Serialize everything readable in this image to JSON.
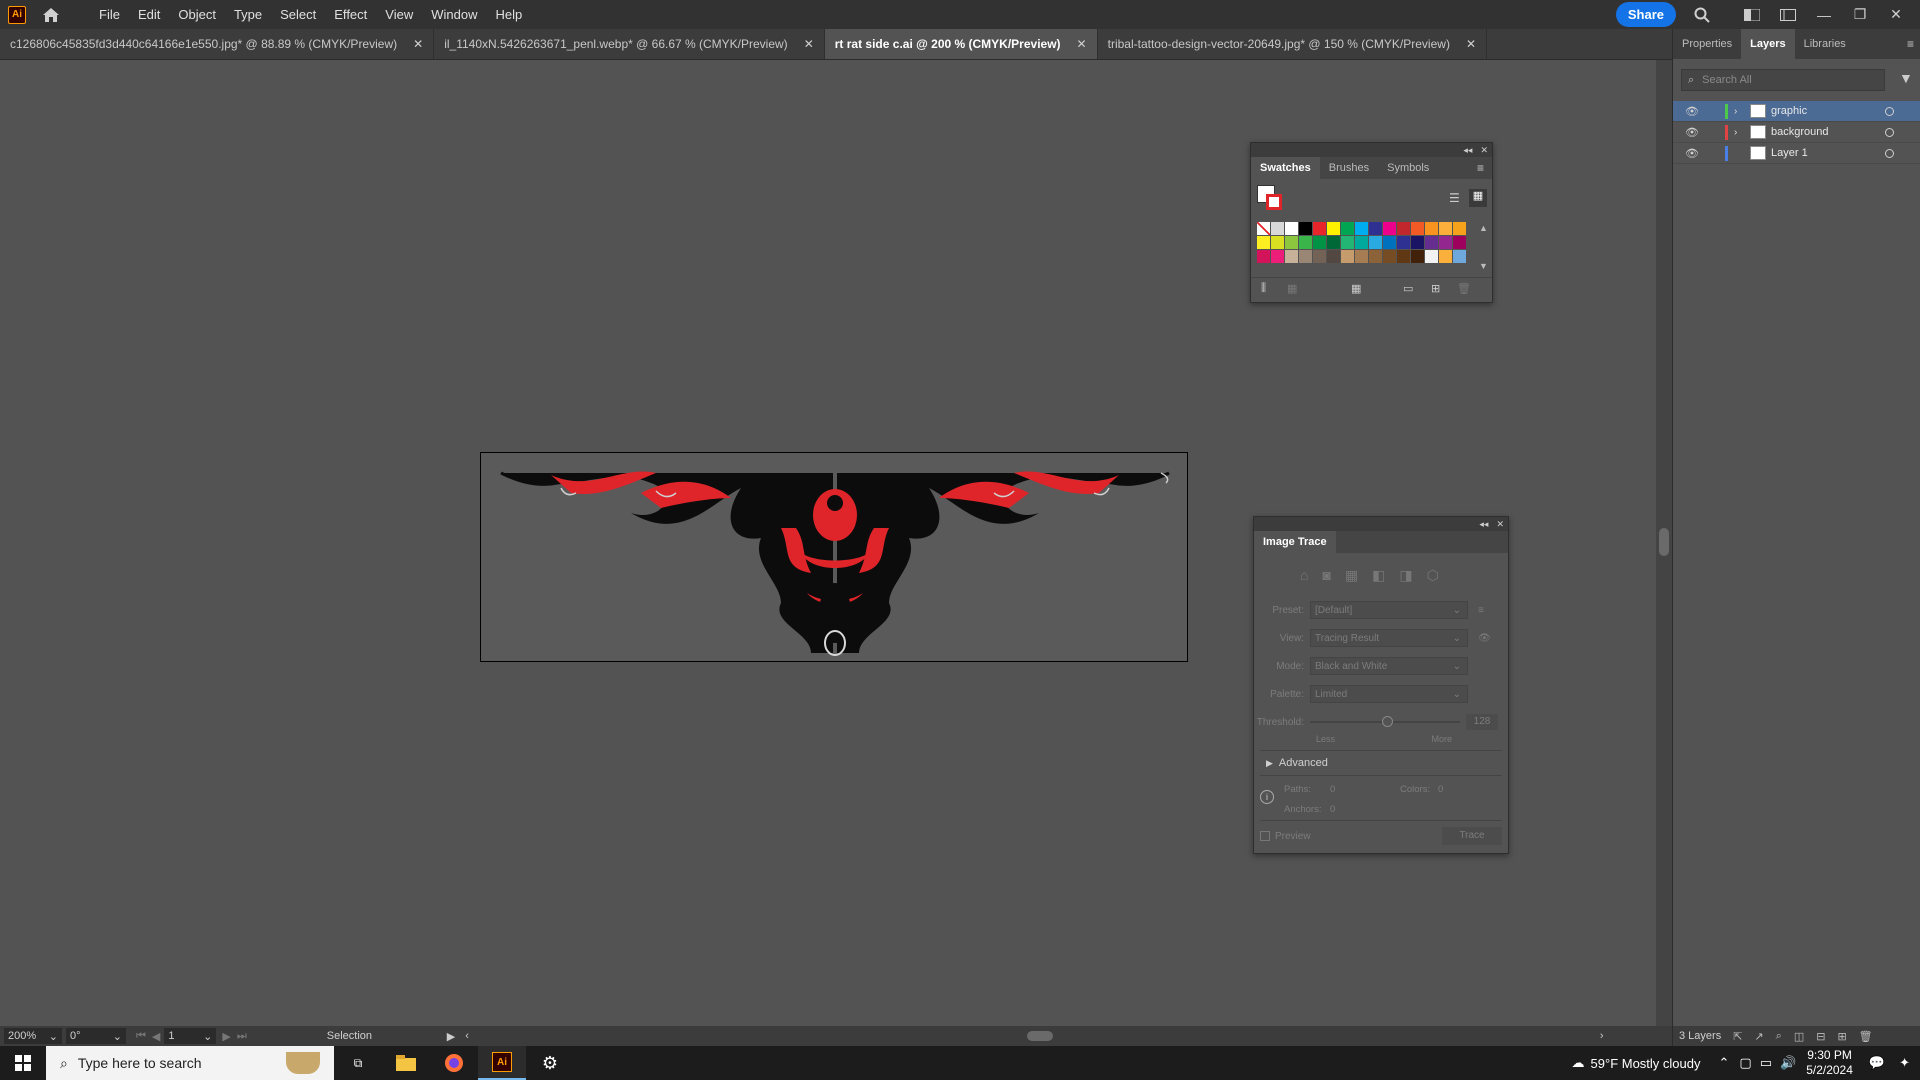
{
  "app": {
    "logo_text": "Ai",
    "menus": [
      "File",
      "Edit",
      "Object",
      "Type",
      "Select",
      "Effect",
      "View",
      "Window",
      "Help"
    ],
    "share_label": "Share"
  },
  "tabs": [
    {
      "label": "c126806c45835fd3d440c64166e1e550.jpg* @ 88.89 % (CMYK/Preview)",
      "active": false
    },
    {
      "label": "il_1140xN.5426263671_penl.webp* @ 66.67 % (CMYK/Preview)",
      "active": false
    },
    {
      "label": "rt rat side c.ai @ 200 % (CMYK/Preview)",
      "active": true
    },
    {
      "label": "tribal-tattoo-design-vector-20649.jpg* @ 150 % (CMYK/Preview)",
      "active": false
    }
  ],
  "right_panel": {
    "tabs": [
      "Properties",
      "Layers",
      "Libraries"
    ],
    "active_tab": "Layers",
    "search_placeholder": "Search All",
    "layers": [
      {
        "name": "graphic",
        "color": "#4cc94c",
        "selected": true,
        "expandable": true
      },
      {
        "name": "background",
        "color": "#e04343",
        "selected": false,
        "expandable": true
      },
      {
        "name": "Layer 1",
        "color": "#4a7fe6",
        "selected": false,
        "expandable": false
      }
    ],
    "layer_count": "3 Layers"
  },
  "swatches": {
    "tabs": [
      "Swatches",
      "Brushes",
      "Symbols"
    ],
    "colors": [
      "#ffffff",
      "#d8d8d8",
      "#ffffff",
      "#000000",
      "#e8252a",
      "#fff200",
      "#00a651",
      "#00aeef",
      "#2e3192",
      "#ec008c",
      "#c1272d",
      "#f15a24",
      "#f7931e",
      "#fbb03b",
      "#f7a21b",
      "#fcee21",
      "#d9e021",
      "#8cc63f",
      "#39b54a",
      "#009245",
      "#006837",
      "#22b573",
      "#00a99d",
      "#29abe2",
      "#0071bc",
      "#2e3192",
      "#1b1464",
      "#662d91",
      "#93278f",
      "#9e005d",
      "#d4145a",
      "#ed1e79",
      "#c7b299",
      "#998675",
      "#736357",
      "#534741",
      "#c69c6d",
      "#a67c52",
      "#8c6239",
      "#754c24",
      "#603813",
      "#42210b",
      "#f2f2f2",
      "#fbb03b",
      "#6ea8dc"
    ]
  },
  "image_trace": {
    "title": "Image Trace",
    "preset_label": "Preset:",
    "preset_value": "[Default]",
    "view_label": "View:",
    "view_value": "Tracing Result",
    "mode_label": "Mode:",
    "mode_value": "Black and White",
    "palette_label": "Palette:",
    "palette_value": "Limited",
    "threshold_label": "Threshold:",
    "threshold_value": "128",
    "less_label": "Less",
    "more_label": "More",
    "advanced_label": "Advanced",
    "paths_label": "Paths:",
    "paths_value": "0",
    "colors_label": "Colors:",
    "colors_value": "0",
    "anchors_label": "Anchors:",
    "anchors_value": "0",
    "preview_label": "Preview",
    "trace_label": "Trace"
  },
  "status": {
    "zoom": "200%",
    "rotation": "0°",
    "artboard": "1",
    "tool": "Selection"
  },
  "taskbar": {
    "search_placeholder": "Type here to search",
    "weather": "59°F  Mostly cloudy",
    "time": "9:30 PM",
    "date": "5/2/2024"
  }
}
